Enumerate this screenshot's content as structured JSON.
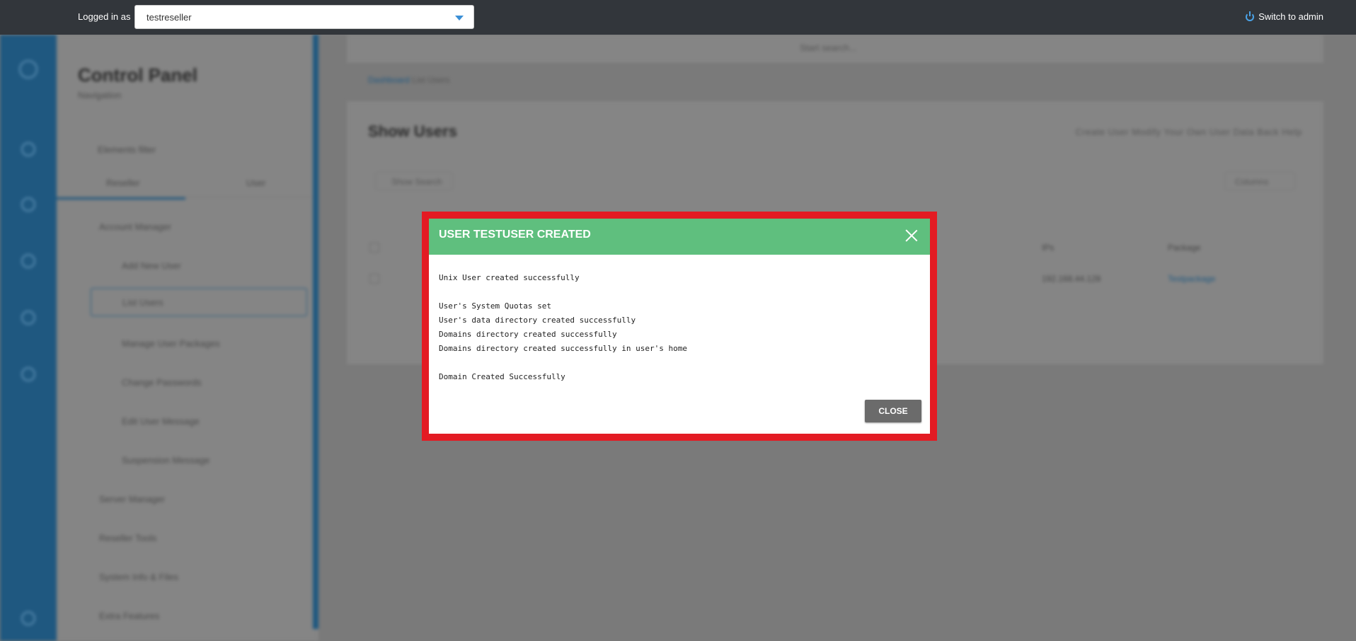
{
  "topbar": {
    "logged_in_label": "Logged in as",
    "user_select_value": "testreseller",
    "switch_admin_label": "Switch to admin"
  },
  "sidebar": {
    "title": "Control Panel",
    "subtitle": "Navigation",
    "filter_placeholder": "Elements filter",
    "tabs": [
      "Reseller",
      "User"
    ],
    "sections": [
      {
        "label": "Account Manager",
        "items": [
          "Add New User",
          "List Users",
          "Manage User Packages",
          "Change Passwords",
          "Edit User Message",
          "Suspension Message"
        ]
      },
      {
        "label": "Server Manager"
      },
      {
        "label": "Reseller Tools"
      },
      {
        "label": "System Info & Files"
      },
      {
        "label": "Extra Features"
      }
    ]
  },
  "main": {
    "search_placeholder": "Start search...",
    "breadcrumb_root": "Dashboard",
    "breadcrumb_current": "List Users",
    "panel_title": "Show Users",
    "actions": "Create User    Modify Your Own User Data    Back    Help",
    "show_search": "Show Search",
    "columns_btn": "Columns",
    "col_ip": "IPs",
    "col_package": "Package",
    "row_ip": "192.168.44.128",
    "row_package": "Testpackage"
  },
  "modal": {
    "title": "USER TESTUSER CREATED",
    "lines": [
      "Unix User created successfully",
      "",
      "User's System Quotas set",
      "User's data directory created successfully",
      "Domains directory created successfully",
      "Domains directory created successfully in user's home",
      "",
      "Domain Created Successfully"
    ],
    "close_label": "CLOSE"
  },
  "colors": {
    "modal_header": "#5fbf7e",
    "highlight_frame": "#e31b23",
    "topbar": "#32363b",
    "accent": "#1f5880"
  }
}
